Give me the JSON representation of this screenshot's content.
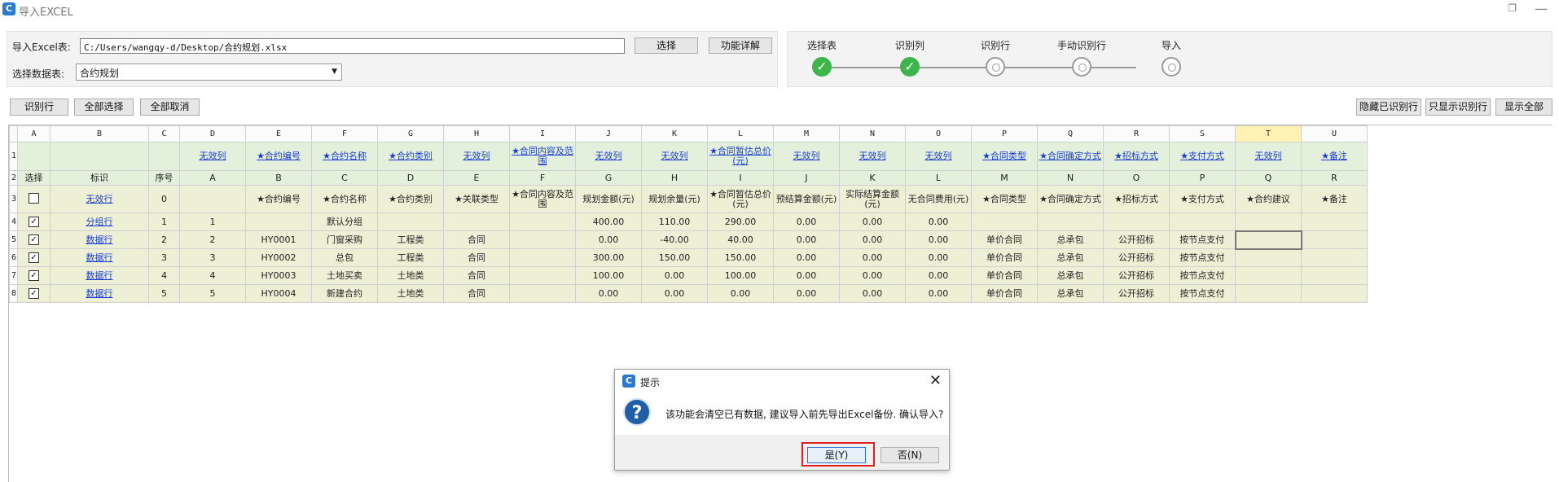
{
  "window": {
    "title": "导入EXCEL",
    "app_icon": "C",
    "restore_glyph": "❐",
    "close_glyph": "—"
  },
  "top": {
    "excel_label": "导入Excel表:",
    "excel_path": "C:/Users/wangqy-d/Desktop/合约规划.xlsx",
    "select_button": "选择",
    "detail_button": "功能详解",
    "sheet_label": "选择数据表:",
    "sheet_value": "合约规划"
  },
  "steps": [
    {
      "label": "选择表",
      "done": true
    },
    {
      "label": "识别列",
      "done": true
    },
    {
      "label": "识别行",
      "done": false
    },
    {
      "label": "手动识别行",
      "done": false
    },
    {
      "label": "导入",
      "done": false
    }
  ],
  "toolbar": {
    "identify_rows": "识别行",
    "select_all": "全部选择",
    "cancel_all": "全部取消",
    "hide_identified": "隐藏已识别行",
    "show_only_identified": "只显示识别行",
    "show_all": "显示全部"
  },
  "grid": {
    "columns": [
      "A",
      "B",
      "C",
      "D",
      "E",
      "F",
      "G",
      "H",
      "I",
      "J",
      "K",
      "L",
      "M",
      "N",
      "O",
      "P",
      "Q",
      "R",
      "S",
      "T",
      "U"
    ],
    "row1": [
      "",
      "",
      "",
      "无效列",
      "★合约编号",
      "★合约名称",
      "★合约类别",
      "无效列",
      "★合同内容及范围",
      "无效列",
      "无效列",
      "★合同暂估总价(元)",
      "无效列",
      "无效列",
      "无效列",
      "★合同类型",
      "★合同确定方式",
      "★招标方式",
      "★支付方式",
      "无效列",
      "★备注"
    ],
    "row2": [
      "选择",
      "标识",
      "序号",
      "A",
      "B",
      "C",
      "D",
      "E",
      "F",
      "G",
      "H",
      "I",
      "J",
      "K",
      "L",
      "M",
      "N",
      "O",
      "P",
      "Q",
      "R"
    ],
    "row3": [
      "",
      "无效行",
      "0",
      "",
      "★合约编号",
      "★合约名称",
      "★合约类别",
      "★关联类型",
      "★合同内容及范围",
      "规划金额(元)",
      "规划余量(元)",
      "★合同暂估总价(元)",
      "预结算金额(元)",
      "实际结算金额(元)",
      "无合同费用(元)",
      "★合同类型",
      "★合同确定方式",
      "★招标方式",
      "★支付方式",
      "★合约建议",
      "★备注"
    ],
    "data_rows": [
      [
        "",
        "分组行",
        "1",
        "1",
        "",
        "默认分组",
        "",
        "",
        "",
        "400.00",
        "110.00",
        "290.00",
        "0.00",
        "0.00",
        "0.00",
        "",
        "",
        "",
        "",
        "",
        ""
      ],
      [
        "",
        "数据行",
        "2",
        "2",
        "HY0001",
        "门窗采购",
        "工程类",
        "合同",
        "",
        "0.00",
        "-40.00",
        "40.00",
        "0.00",
        "0.00",
        "0.00",
        "单价合同",
        "总承包",
        "公开招标",
        "按节点支付",
        "",
        ""
      ],
      [
        "",
        "数据行",
        "3",
        "3",
        "HY0002",
        "总包",
        "工程类",
        "合同",
        "",
        "300.00",
        "150.00",
        "150.00",
        "0.00",
        "0.00",
        "0.00",
        "单价合同",
        "总承包",
        "公开招标",
        "按节点支付",
        "",
        ""
      ],
      [
        "",
        "数据行",
        "4",
        "4",
        "HY0003",
        "土地买卖",
        "土地类",
        "合同",
        "",
        "100.00",
        "0.00",
        "100.00",
        "0.00",
        "0.00",
        "0.00",
        "单价合同",
        "总承包",
        "公开招标",
        "按节点支付",
        "",
        ""
      ],
      [
        "",
        "数据行",
        "5",
        "5",
        "HY0004",
        "新建合约",
        "土地类",
        "合同",
        "",
        "0.00",
        "0.00",
        "0.00",
        "0.00",
        "0.00",
        "0.00",
        "单价合同",
        "总承包",
        "公开招标",
        "按节点支付",
        "",
        ""
      ]
    ],
    "row_numbers": [
      "1",
      "2",
      "3",
      "4",
      "5",
      "6",
      "7",
      "8"
    ],
    "check_glyph": "✓"
  },
  "dialog": {
    "title": "提示",
    "icon": "C",
    "question_glyph": "?",
    "message": "该功能会清空已有数据, 建议导入前先导出Excel备份. 确认导入?",
    "yes_button": "是(Y)",
    "no_button": "否(N)",
    "close_glyph": "✕"
  }
}
